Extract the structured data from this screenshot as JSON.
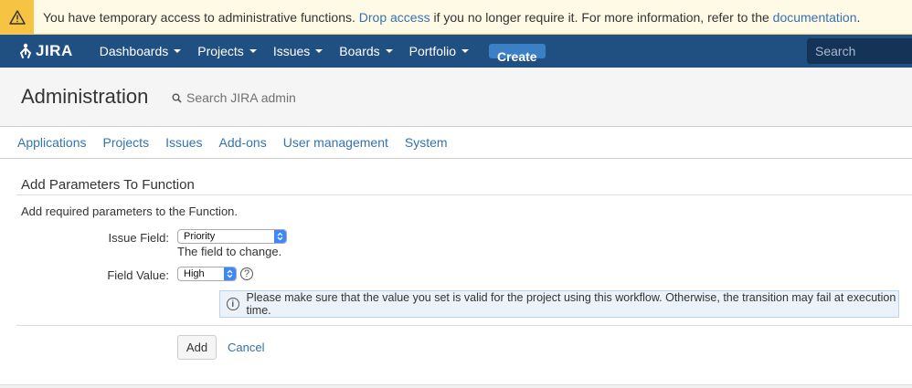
{
  "banner": {
    "text_before": "You have temporary access to administrative functions.",
    "drop_access_link": "Drop access",
    "text_middle": "if you no longer require it. For more information, refer to the",
    "documentation_link": "documentation",
    "text_after": "."
  },
  "topnav": {
    "logo_text": "JIRA",
    "items": [
      {
        "label": "Dashboards"
      },
      {
        "label": "Projects"
      },
      {
        "label": "Issues"
      },
      {
        "label": "Boards"
      },
      {
        "label": "Portfolio"
      }
    ],
    "create_label": "Create",
    "search_placeholder": "Search"
  },
  "admin": {
    "title": "Administration",
    "search_placeholder": "Search JIRA admin",
    "tabs": [
      {
        "label": "Applications"
      },
      {
        "label": "Projects"
      },
      {
        "label": "Issues"
      },
      {
        "label": "Add-ons"
      },
      {
        "label": "User management"
      },
      {
        "label": "System"
      }
    ]
  },
  "form": {
    "title": "Add Parameters To Function",
    "description": "Add required parameters to the Function.",
    "issue_field_label": "Issue Field:",
    "issue_field_value": "Priority",
    "issue_field_hint": "The field to change.",
    "field_value_label": "Field Value:",
    "field_value_value": "High",
    "help_glyph": "?",
    "info_message": "Please make sure that the value you set is valid for the project using this workflow. Otherwise, the transition may fail at execution time.",
    "add_label": "Add",
    "cancel_label": "Cancel"
  },
  "colors": {
    "nav_bg": "#205081",
    "link": "#3572b0",
    "warning": "#f6c342"
  }
}
